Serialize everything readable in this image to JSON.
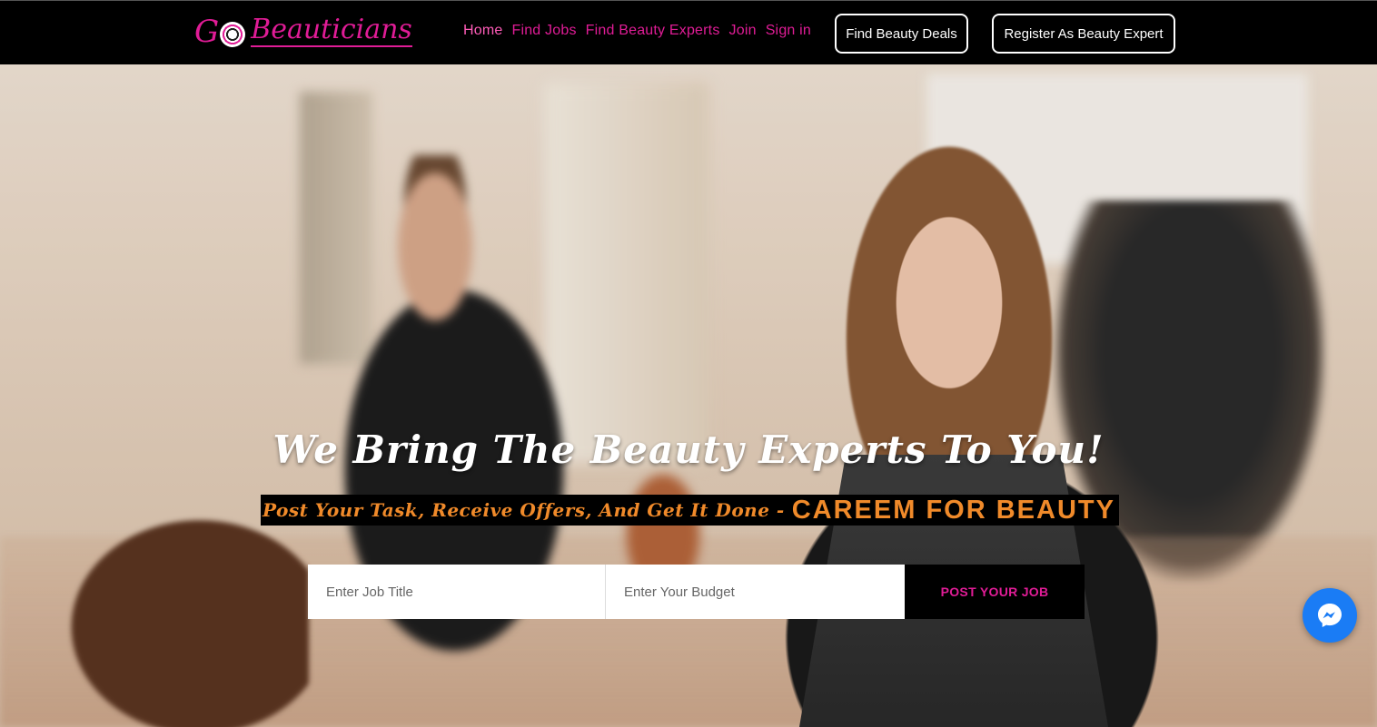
{
  "brand": {
    "logo_g": "G",
    "logo_rest": "Beauticians"
  },
  "nav": {
    "links": [
      {
        "label": "Home",
        "active": true
      },
      {
        "label": "Find Jobs",
        "active": false
      },
      {
        "label": "Find Beauty Experts",
        "active": false
      },
      {
        "label": "Join",
        "active": false
      },
      {
        "label": "Sign in",
        "active": false
      }
    ],
    "deals_button": "Find Beauty Deals",
    "register_button": "Register As Beauty Expert"
  },
  "hero": {
    "heading": "We Bring The Beauty Experts To You!",
    "tagline_script": "Post Your Task, Receive Offers, And Get It Done -",
    "tagline_caps": "CAREEM FOR BEAUTY"
  },
  "form": {
    "job_title_placeholder": "Enter Job Title",
    "budget_placeholder": "Enter Your Budget",
    "submit_label": "POST YOUR JOB"
  },
  "chat": {
    "icon": "messenger-icon"
  },
  "colors": {
    "brand_pink": "#e01c96",
    "accent_orange": "#f08a2a",
    "messenger_blue": "#1a7cf5",
    "navbar_bg": "#000000"
  }
}
